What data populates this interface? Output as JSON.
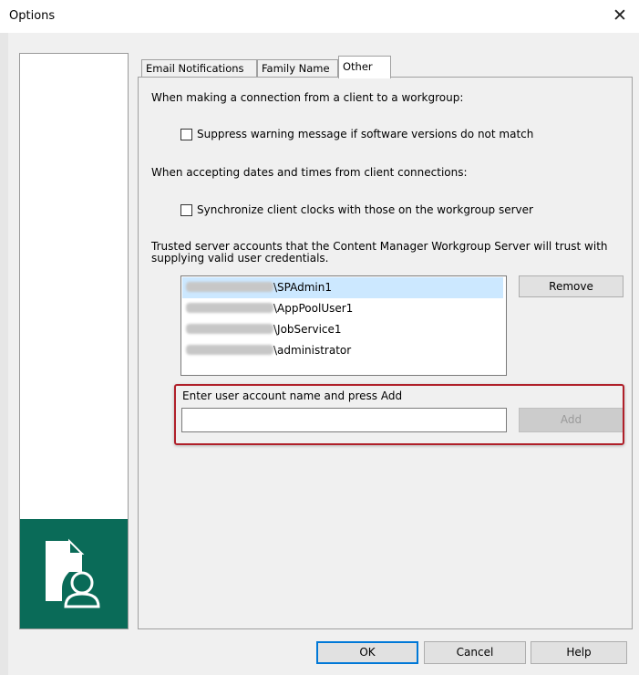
{
  "window": {
    "title": "Options",
    "close_symbol": "✕"
  },
  "tabs": [
    {
      "label": "Email Notifications",
      "active": false
    },
    {
      "label": "Family Name",
      "active": false
    },
    {
      "label": "Other",
      "active": true
    }
  ],
  "other": {
    "section1_label": "When making a connection from a client to a workgroup:",
    "checkbox1_label": "Suppress warning message if software versions do not match",
    "checkbox1_checked": false,
    "section2_label": "When accepting dates and times from client connections:",
    "checkbox2_label": "Synchronize client clocks with those on the workgroup server",
    "checkbox2_checked": false,
    "trusted_label_line1": "Trusted server accounts that the Content Manager Workgroup Server will trust with",
    "trusted_label_line2": "supplying valid user credentials.",
    "accounts": [
      {
        "user": "\\SPAdmin1",
        "selected": true
      },
      {
        "user": "\\AppPoolUser1",
        "selected": false
      },
      {
        "user": "\\JobService1",
        "selected": false
      },
      {
        "user": "\\administrator",
        "selected": false
      }
    ],
    "remove_label": "Remove",
    "add_prompt": "Enter user account name and press Add",
    "add_input_value": "",
    "add_label": "Add"
  },
  "footer": {
    "ok_label": "OK",
    "cancel_label": "Cancel",
    "help_label": "Help"
  },
  "colors": {
    "brand": "#0a6b58",
    "selection": "#cce8ff",
    "highlight_border": "#b0202a",
    "default_button": "#0078d7"
  }
}
